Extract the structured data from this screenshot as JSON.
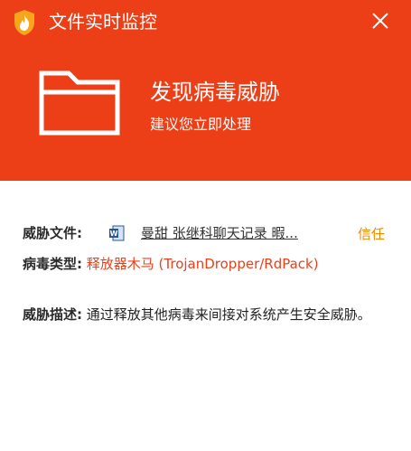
{
  "window": {
    "title": "文件实时监控",
    "close_label": "关闭"
  },
  "alert": {
    "title": "发现病毒威胁",
    "subtitle": "建议您立即处理"
  },
  "threat": {
    "file_label": "威胁文件:",
    "file_name": "曼甜 张继科聊天记录 暇...",
    "trust_label": "信任",
    "type_label": "病毒类型:",
    "type_value": "释放器木马 (TrojanDropper/RdPack)",
    "desc_label": "威胁描述:",
    "desc_value": "通过释放其他病毒来间接对系统产生安全威胁。"
  },
  "colors": {
    "header_bg": "#ec3e17",
    "trust_link": "#f08a00",
    "type_value": "#e8411b"
  },
  "icons": {
    "app": "shield-flame-icon",
    "close": "close-icon",
    "folder": "folder-icon",
    "file": "word-document-icon"
  }
}
